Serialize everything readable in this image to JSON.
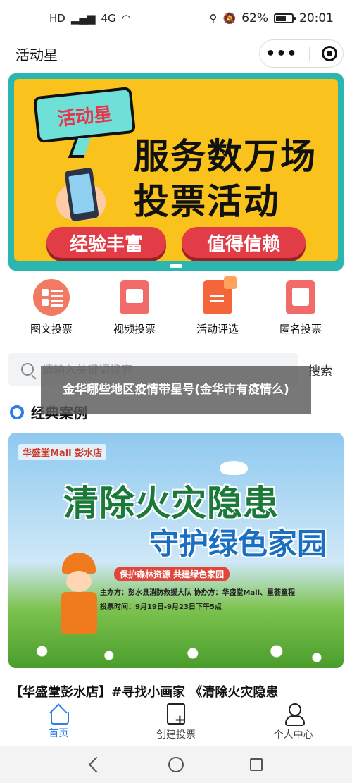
{
  "status_bar": {
    "signal_label": "4G",
    "battery_percent": "62%",
    "battery_level": 0.62,
    "time": "20:01"
  },
  "header": {
    "title": "活动星",
    "more_label": "•••"
  },
  "banner": {
    "badge": "活动星",
    "line1": "服务数万场",
    "line2": "投票活动",
    "pill_left": "经验丰富",
    "pill_right": "值得信赖"
  },
  "categories": [
    {
      "label": "图文投票",
      "icon": "image-text-vote-icon"
    },
    {
      "label": "视频投票",
      "icon": "video-vote-icon"
    },
    {
      "label": "活动评选",
      "icon": "activity-selection-icon"
    },
    {
      "label": "匿名投票",
      "icon": "anonymous-vote-icon"
    }
  ],
  "search": {
    "placeholder": "请输入关键词搜索",
    "button": "搜索"
  },
  "overlay_caption": "金华哪些地区疫情带星号(金华市有疫情么)",
  "section": {
    "title": "经典案例"
  },
  "case": {
    "logo": "华盛堂Mall 彭水店",
    "headline1": "清除火灾隐患",
    "headline2": "守护绿色家园",
    "tagline": "保护森林资源 共建绿色家园",
    "line1": "主办方：彭水县消防救援大队   协办方：华盛堂Mall、星荟童程",
    "line2": "投票时间：9月19日-9月23日下午5点",
    "title": "【华盛堂彭水店】#寻找小画家 《清除火灾隐患"
  },
  "tabbar": {
    "home": "首页",
    "create": "创建投票",
    "profile": "个人中心"
  },
  "colors": {
    "accent": "#2b7fe8",
    "banner_bg": "#f9c21c",
    "pill": "#e23c46"
  }
}
